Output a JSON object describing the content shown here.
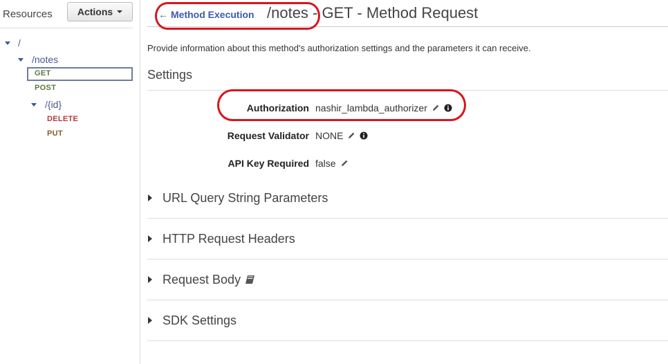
{
  "sidebar": {
    "title": "Resources",
    "actions_label": "Actions",
    "tree": {
      "root": "/",
      "notes": "/notes",
      "get": "GET",
      "post": "POST",
      "id": "/{id}",
      "delete": "DELETE",
      "put": "PUT"
    }
  },
  "header": {
    "back_label": "Method Execution",
    "title": "/notes - GET - Method Request"
  },
  "main": {
    "description": "Provide information about this method's authorization settings and the parameters it can receive.",
    "settings_title": "Settings",
    "settings": {
      "authorization_label": "Authorization",
      "authorization_value": "nashir_lambda_authorizer",
      "validator_label": "Request Validator",
      "validator_value": "NONE",
      "api_key_label": "API Key Required",
      "api_key_value": "false"
    },
    "sections": {
      "query": "URL Query String Parameters",
      "headers": "HTTP Request Headers",
      "body": "Request Body",
      "sdk": "SDK Settings"
    }
  },
  "colors": {
    "link": "#3b5bab",
    "annotation": "#d9141c",
    "get": "#5a7a3a",
    "delete": "#b53a3a"
  }
}
